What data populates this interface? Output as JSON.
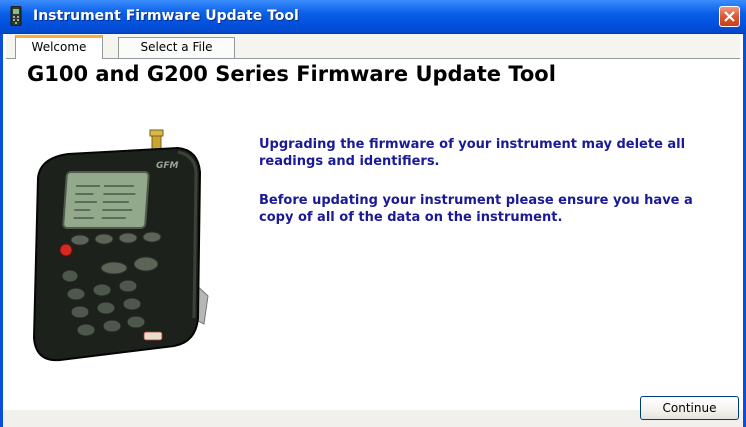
{
  "window": {
    "title": "Instrument Firmware Update Tool",
    "app_icon": "handheld-device-icon",
    "close_icon": "close-icon"
  },
  "tabs": [
    {
      "label": "Welcome",
      "active": true
    },
    {
      "label": "Select a File",
      "active": false
    }
  ],
  "content": {
    "heading": "G100 and G200 Series Firmware Update Tool",
    "warning_1": "Upgrading the firmware of your instrument may delete all readings and identifiers.",
    "warning_2": "Before updating your instrument please ensure you have a copy of all of the data on the instrument.",
    "device_brand": "GFM",
    "device_image": "gas-analyzer-device-image"
  },
  "actions": {
    "continue_label": "Continue"
  },
  "colors": {
    "titlebar": "#0a5fe8",
    "message_text": "#1a1a96",
    "active_tab_accent": "#f4b139",
    "close_button": "#e0552d"
  }
}
